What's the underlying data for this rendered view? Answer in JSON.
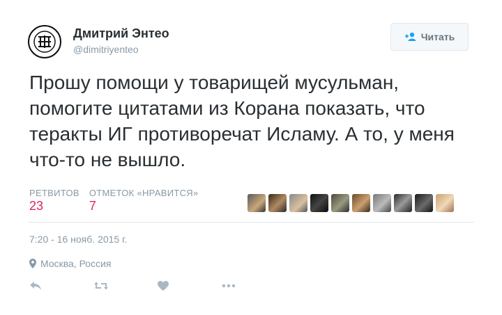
{
  "tweet": {
    "author_name": "Дмитрий Энтео",
    "author_handle": "@dimitriyenteo",
    "follow_label": "Читать",
    "text": "Прошу помощи у товарищей мусульман, помогите цитатами из Корана показать, что теракты ИГ противоречат Исламу. А то, у меня что-то не вышло.",
    "retweets_label": "РЕТВИТОВ",
    "retweets_count": "23",
    "likes_label": "ОТМЕТОК «НРАВИТСЯ»",
    "likes_count": "7",
    "timestamp": "7:20 - 16 нояб. 2015 г.",
    "location": "Москва, Россия"
  },
  "colors": {
    "accent_like": "#e0245e",
    "muted": "#8899a6",
    "text": "#292f33",
    "button_bg": "#f5f8fa"
  },
  "icons": {
    "follow": "add-user-icon",
    "location": "location-pin-icon",
    "reply": "reply-icon",
    "retweet": "retweet-icon",
    "like": "heart-icon",
    "more": "more-icon"
  }
}
